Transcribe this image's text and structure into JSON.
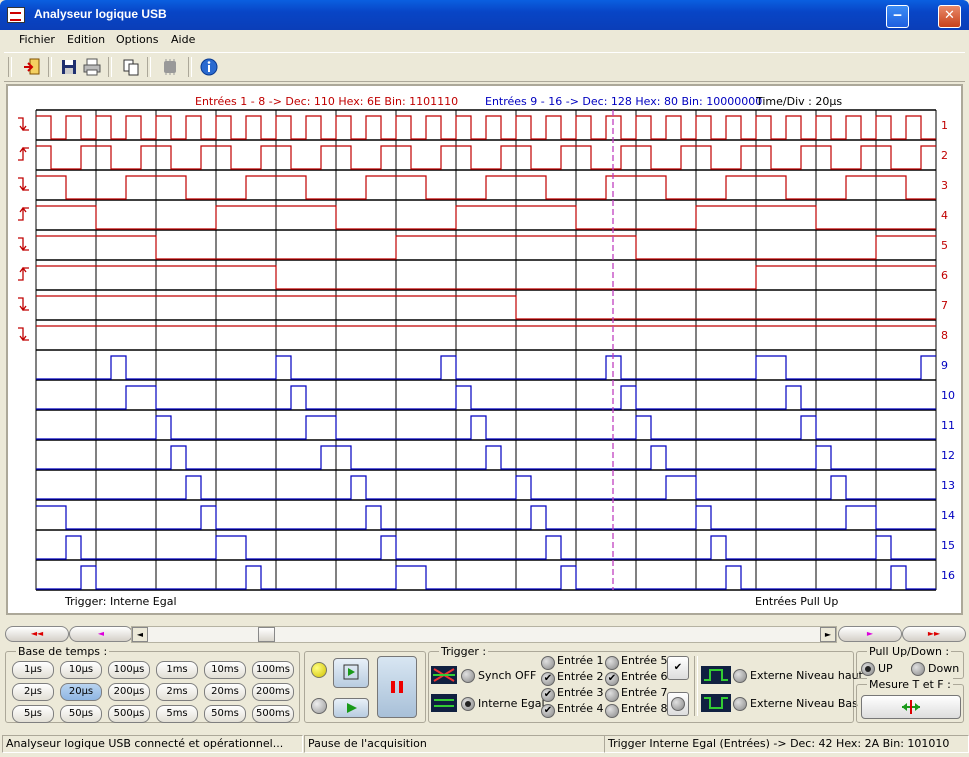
{
  "window": {
    "title": "Analyseur logique USB"
  },
  "menu": [
    "Fichier",
    "Edition",
    "Options",
    "Aide"
  ],
  "scope": {
    "header_left": "Entrées 1 - 8 -> Dec: 110   Hex: 6E   Bin: 1101110",
    "header_right": "Entrées 9 - 16 -> Dec: 128   Hex: 80   Bin: 10000000",
    "time_div": "Time/Div : 20µs",
    "footer_left": "Trigger: Interne Egal",
    "footer_right": "Entrées Pull Up",
    "channels": [
      "1",
      "2",
      "3",
      "4",
      "5",
      "6",
      "7",
      "8",
      "9",
      "10",
      "11",
      "12",
      "13",
      "14",
      "15",
      "16"
    ],
    "edge_icons": [
      "falling-edge",
      "rising-edge",
      "falling-edge",
      "rising-edge",
      "falling-edge",
      "rising-edge",
      "falling-edge",
      "falling-edge"
    ],
    "colors": {
      "red": "#c00000",
      "blue": "#0000c0",
      "cursor": "#c040c0"
    }
  },
  "nav": {
    "far_left": "◄◄",
    "left": "◄",
    "right": "►",
    "far_right": "►►"
  },
  "timebase": {
    "label": "Base de temps :",
    "buttons": [
      "1µs",
      "10µs",
      "100µs",
      "1ms",
      "10ms",
      "100ms",
      "2µs",
      "20µs",
      "200µs",
      "2ms",
      "20ms",
      "200ms",
      "5µs",
      "50µs",
      "500µs",
      "5ms",
      "50ms",
      "500ms"
    ],
    "selected": "20µs"
  },
  "trigger": {
    "label": "Trigger :",
    "synch_off": "Synch OFF",
    "interne_egal": "Interne Egal",
    "entrees": [
      "Entrée 1",
      "Entrée 2",
      "Entrée 3",
      "Entrée 4",
      "Entrée 5",
      "Entrée 6",
      "Entrée 7",
      "Entrée 8"
    ],
    "checked": [
      false,
      true,
      true,
      true,
      false,
      true,
      false,
      false
    ],
    "ext_haut": "Externe Niveau haut",
    "ext_bas": "Externe Niveau Bas"
  },
  "pullup": {
    "label": "Pull Up/Down :",
    "up": "UP",
    "down": "Down"
  },
  "mesure": {
    "label": "Mesure T et F :"
  },
  "status": {
    "left": "Analyseur logique USB connecté et opérationnel...",
    "middle": "Pause de l'acquisition",
    "right": "Trigger Interne Egal (Entrées) -> Dec: 42   Hex: 2A   Bin: 101010"
  }
}
